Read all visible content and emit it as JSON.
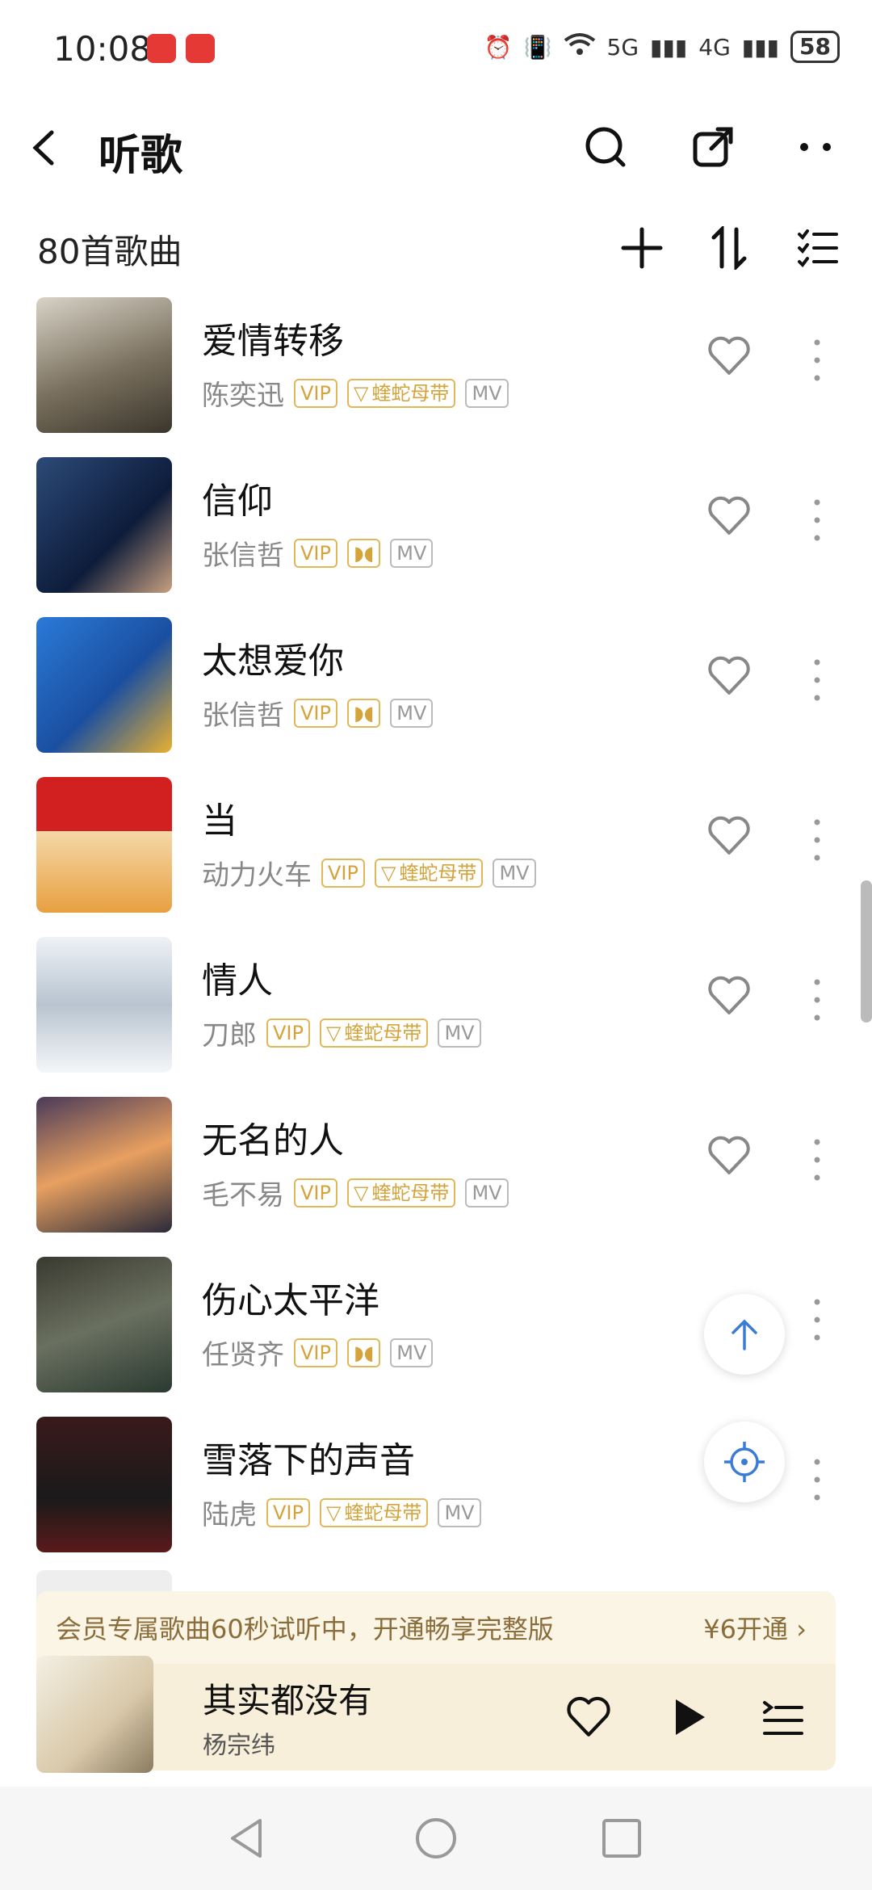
{
  "status": {
    "time": "10:08",
    "battery": "58",
    "network1": "5G",
    "network2": "4G"
  },
  "header": {
    "title": "听歌"
  },
  "subheader": {
    "count_label": "80首歌曲"
  },
  "songs": [
    {
      "title": "爱情转移",
      "artist": "陈奕迅",
      "vip": "VIP",
      "badge": "蝰蛇母带",
      "mv": "MV"
    },
    {
      "title": "信仰",
      "artist": "张信哲",
      "vip": "VIP",
      "badge": "",
      "mv": "MV"
    },
    {
      "title": "太想爱你",
      "artist": "张信哲",
      "vip": "VIP",
      "badge": "",
      "mv": "MV"
    },
    {
      "title": "当",
      "artist": "动力火车",
      "vip": "VIP",
      "badge": "蝰蛇母带",
      "mv": "MV"
    },
    {
      "title": "情人",
      "artist": "刀郎",
      "vip": "VIP",
      "badge": "蝰蛇母带",
      "mv": "MV"
    },
    {
      "title": "无名的人",
      "artist": "毛不易",
      "vip": "VIP",
      "badge": "蝰蛇母带",
      "mv": "MV"
    },
    {
      "title": "伤心太平洋",
      "artist": "任贤齐",
      "vip": "VIP",
      "badge": "",
      "mv": "MV"
    },
    {
      "title": "雪落下的声音",
      "artist": "陆虎",
      "vip": "VIP",
      "badge": "蝰蛇母带",
      "mv": "MV"
    }
  ],
  "banner": {
    "text": "会员专属歌曲60秒试听中，开通畅享完整版",
    "price": "¥6开通"
  },
  "player": {
    "title": "其实都没有",
    "artist": "杨宗纬"
  },
  "colors": {
    "accent": "#3a7bd5",
    "gold": "#d4a33a"
  }
}
